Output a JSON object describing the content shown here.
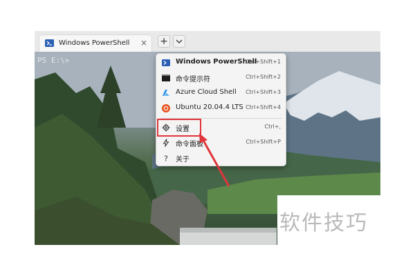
{
  "tab": {
    "title": "Windows PowerShell",
    "close": "×"
  },
  "tabbar": {
    "new_tab": "+",
    "dropdown": "⌄"
  },
  "terminal": {
    "prompt": "PS E:\\>"
  },
  "menu": {
    "items": [
      {
        "label": "Windows PowerShell",
        "shortcut": "Ctrl+Shift+1",
        "icon": "powershell-icon"
      },
      {
        "label": "命令提示符",
        "shortcut": "Ctrl+Shift+2",
        "icon": "command-prompt-icon"
      },
      {
        "label": "Azure Cloud Shell",
        "shortcut": "Ctrl+Shift+3",
        "icon": "azure-icon"
      },
      {
        "label": "Ubuntu 20.04.4 LTS",
        "shortcut": "Ctrl+Shift+4",
        "icon": "ubuntu-icon"
      },
      {
        "label": "设置",
        "shortcut": "Ctrl+,",
        "icon": "gear-icon"
      },
      {
        "label": "命令面板",
        "shortcut": "Ctrl+Shift+P",
        "icon": "lightning-icon"
      },
      {
        "label": "关于",
        "shortcut": "",
        "icon": "question-icon"
      }
    ]
  },
  "watermark": "软件技巧",
  "colors": {
    "highlight": "#e0353b",
    "powershell": "#2a5fb5",
    "ubuntu": "#e95420"
  }
}
